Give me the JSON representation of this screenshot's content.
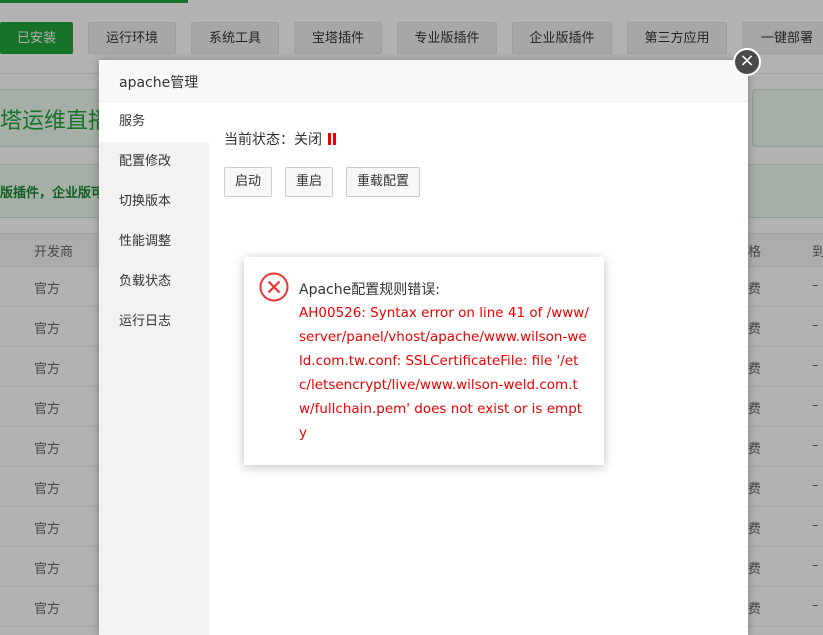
{
  "tabs": [
    {
      "label": "已安装",
      "active": true
    },
    {
      "label": "运行环境"
    },
    {
      "label": "系统工具"
    },
    {
      "label": "宝塔插件"
    },
    {
      "label": "专业版插件"
    },
    {
      "label": "企业版插件"
    },
    {
      "label": "第三方应用"
    },
    {
      "label": "一键部署"
    }
  ],
  "banner": {
    "text": "塔运维直播"
  },
  "notice": {
    "text": "版插件，企业版可"
  },
  "table": {
    "headers": {
      "developer": "开发商",
      "price": "价格",
      "expire": "到"
    },
    "rows": [
      {
        "developer": "官方",
        "price": "免费",
        "expire": "–"
      },
      {
        "developer": "官方",
        "price": "免费",
        "expire": "–"
      },
      {
        "developer": "官方",
        "price": "免费",
        "expire": "–"
      },
      {
        "developer": "官方",
        "price": "免费",
        "expire": "–"
      },
      {
        "developer": "官方",
        "price": "免费",
        "expire": "–"
      },
      {
        "developer": "官方",
        "price": "免费",
        "expire": "–"
      },
      {
        "developer": "官方",
        "price": "免费",
        "expire": "–"
      },
      {
        "developer": "官方",
        "price": "免费",
        "expire": "–"
      },
      {
        "developer": "官方",
        "price": "免费",
        "expire": "–"
      }
    ]
  },
  "modal": {
    "title": "apache管理",
    "close_glyph": "×",
    "menu": [
      "服务",
      "配置修改",
      "切换版本",
      "性能调整",
      "负载状态",
      "运行日志"
    ],
    "status_label": "当前状态：",
    "status_value": "关闭",
    "buttons": {
      "start": "启动",
      "restart": "重启",
      "reload": "重载配置"
    }
  },
  "error": {
    "title": "Apache配置规则错误:",
    "message": "AH00526: Syntax error on line 41 of /www/server/panel/vhost/apache/www.wilson-weld.com.tw.conf: SSLCertificateFile: file '/etc/letsencrypt/live/www.wilson-weld.com.tw/fullchain.pem' does not exist or is empty"
  },
  "colors": {
    "accent": "#20a53a",
    "error": "#ee0000",
    "status_icon": "#ee0000"
  }
}
